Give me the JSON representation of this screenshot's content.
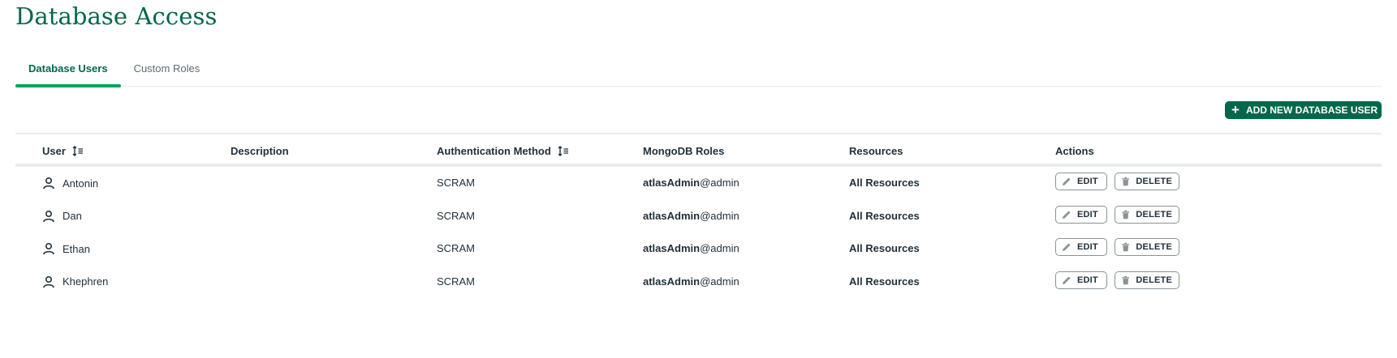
{
  "page": {
    "title": "Database Access"
  },
  "tabs": [
    {
      "label": "Database Users",
      "active": true
    },
    {
      "label": "Custom Roles",
      "active": false
    }
  ],
  "toolbar": {
    "add_user_label": "ADD NEW DATABASE USER",
    "add_user_icon": "plus-icon"
  },
  "table": {
    "columns": [
      "User",
      "Description",
      "Authentication Method",
      "MongoDB Roles",
      "Resources",
      "Actions"
    ],
    "sortable_columns": [
      "User",
      "Authentication Method"
    ],
    "rows": [
      {
        "user": "Antonin",
        "description": "",
        "auth": "SCRAM",
        "role": "atlasAdmin",
        "role_db": "@admin",
        "resources": "All Resources"
      },
      {
        "user": "Dan",
        "description": "",
        "auth": "SCRAM",
        "role": "atlasAdmin",
        "role_db": "@admin",
        "resources": "All Resources"
      },
      {
        "user": "Ethan",
        "description": "",
        "auth": "SCRAM",
        "role": "atlasAdmin",
        "role_db": "@admin",
        "resources": "All Resources"
      },
      {
        "user": "Khephren",
        "description": "",
        "auth": "SCRAM",
        "role": "atlasAdmin",
        "role_db": "@admin",
        "resources": "All Resources"
      }
    ],
    "edit_label": "EDIT",
    "delete_label": "DELETE"
  },
  "colors": {
    "brand_green": "#00684a",
    "tab_underline": "#00a35c",
    "text": "#21313c",
    "muted_text": "#5c6c75",
    "border": "#e8edeb",
    "button_border": "#889397"
  }
}
